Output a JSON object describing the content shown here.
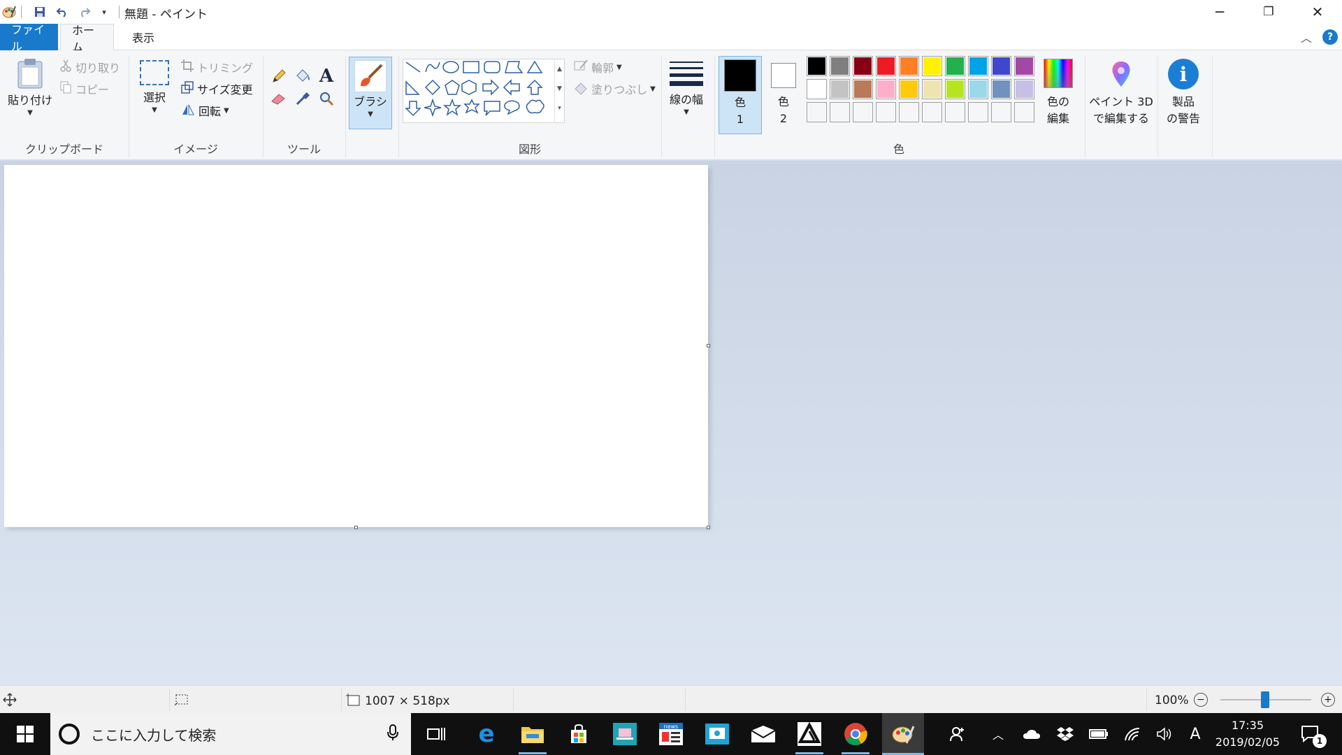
{
  "window": {
    "title": "無題 - ペイント",
    "controls": {
      "minimize": "─",
      "maximize": "❐",
      "close": "✕"
    }
  },
  "tabs": {
    "file": "ファイル",
    "home": "ホーム",
    "view": "表示"
  },
  "ribbon": {
    "clipboard": {
      "paste": "貼り付け",
      "cut": "切り取り",
      "copy": "コピー",
      "group": "クリップボード"
    },
    "image": {
      "select": "選択",
      "crop": "トリミング",
      "resize": "サイズ変更",
      "rotate": "回転",
      "group": "イメージ"
    },
    "tools": {
      "group": "ツール"
    },
    "brushes": {
      "label": "ブラシ"
    },
    "shapes": {
      "outline": "輪郭",
      "fill": "塗りつぶし",
      "group": "図形"
    },
    "size": {
      "label": "線の幅"
    },
    "colors": {
      "color1_line1": "色",
      "color1_line2": "1",
      "color2_line1": "色",
      "color2_line2": "2",
      "edit_line1": "色の",
      "edit_line2": "編集",
      "group": "色",
      "color1_value": "#000000",
      "color2_value": "#ffffff",
      "palette_row1": [
        "#000000",
        "#7f7f7f",
        "#880015",
        "#ed1c24",
        "#ff7f27",
        "#fff200",
        "#22b14c",
        "#00a2e8",
        "#3f48cc",
        "#a349a4"
      ],
      "palette_row2": [
        "#ffffff",
        "#c3c3c3",
        "#b97a57",
        "#ffaec9",
        "#ffc90e",
        "#efe4b0",
        "#b5e61d",
        "#99d9ea",
        "#7092be",
        "#c8bfe7"
      ]
    },
    "paint3d": {
      "line1": "ペイント 3D",
      "line2": "で編集する"
    },
    "warning": {
      "line1": "製品",
      "line2": "の警告"
    }
  },
  "status": {
    "canvas_size": "1007 × 518px",
    "zoom": "100%"
  },
  "taskbar": {
    "search_placeholder": "ここに入力して検索",
    "time": "17:35",
    "date": "2019/02/05",
    "notification_count": "1",
    "ime": "A"
  }
}
